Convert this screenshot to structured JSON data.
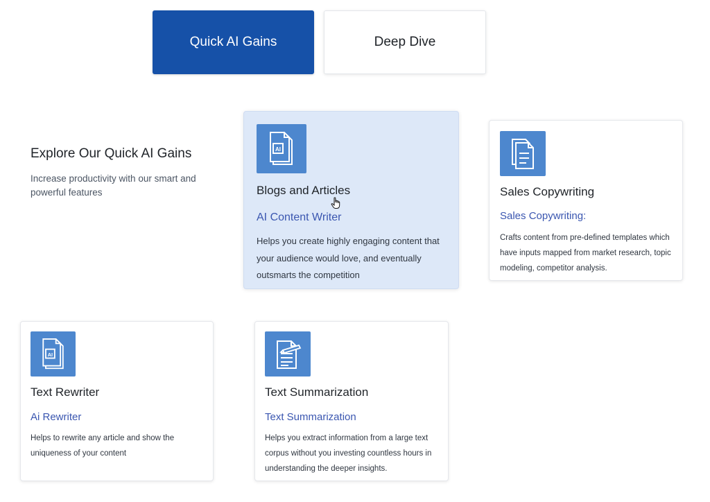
{
  "tabs": [
    {
      "label": "Quick AI Gains",
      "active": true
    },
    {
      "label": "Deep Dive",
      "active": false
    }
  ],
  "intro": {
    "title": "Explore Our Quick AI Gains",
    "description": "Increase productivity with our smart and powerful features"
  },
  "cards": [
    {
      "icon": "ai-document-icon",
      "title": "Blogs and Articles",
      "subtitle": "AI Content Writer",
      "description": "Helps you create highly engaging content that your audience would love, and eventually outsmarts the competition",
      "highlighted": true
    },
    {
      "icon": "copy-document-icon",
      "title": "Sales Copywriting",
      "subtitle": "Sales Copywriting:",
      "description": "Crafts content from pre-defined templates which have inputs mapped from market research, topic modeling, competitor analysis.",
      "highlighted": false
    },
    {
      "icon": "ai-document-icon",
      "title": "Text Rewriter",
      "subtitle": "Ai Rewriter",
      "description": "Helps to rewrite any article and show the uniqueness of your content",
      "highlighted": false
    },
    {
      "icon": "document-edit-icon",
      "title": "Text Summarization",
      "subtitle": "Text Summarization",
      "description": "Helps you extract information from a large text corpus without you investing countless hours in understanding the deeper insights.",
      "highlighted": false
    }
  ],
  "colors": {
    "accent": "#1651a8",
    "icon_bg": "#4d87ce",
    "highlight_bg": "#dde8f8",
    "subtitle": "#3a56b0"
  }
}
